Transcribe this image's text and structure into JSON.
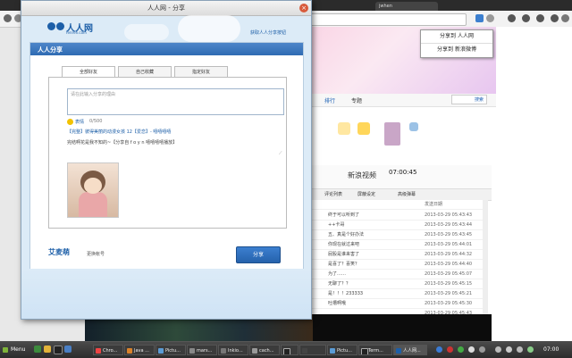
{
  "browser": {
    "tab_label": "jwhen",
    "share_menu": [
      "分享到 人人网",
      "分享到 新浪微博"
    ],
    "nav_items": [
      "排行",
      "专题"
    ],
    "search_label": "搜索",
    "video_site_label": "新浪视频",
    "video_time": "07:00:45",
    "toolbar_items": [
      "评论列表",
      "屏蔽设定",
      "高级弹幕"
    ],
    "comment_header_time": "发送日期",
    "comments": [
      {
        "text": "终于可以听到了",
        "time": "2013-03-29 05:43:43"
      },
      {
        "text": "++卡哥",
        "time": "2013-03-29 05:43:44"
      },
      {
        "text": "五、真是个好办法",
        "time": "2013-03-29 05:43:45"
      },
      {
        "text": "你现在就过来吧",
        "time": "2013-03-29 05:44:01"
      },
      {
        "text": "屁股是谁来害了",
        "time": "2013-03-29 05:44:32"
      },
      {
        "text": "是喜了？喜笑？",
        "time": "2013-03-29 05:44:40"
      },
      {
        "text": "为了……",
        "time": "2013-03-29 05:45:07"
      },
      {
        "text": "无聊了？？",
        "time": "2013-03-29 05:45:15"
      },
      {
        "text": "是！！！233333",
        "time": "2013-03-29 05:45:21"
      },
      {
        "text": "吐槽啊哦",
        "time": "2013-03-29 05:45:30"
      },
      {
        "text": "",
        "time": "2013-03-29 05:45:43"
      }
    ]
  },
  "dialog": {
    "title": "人人网 - 分享",
    "logo_text": "人人网",
    "logo_sub": "renren.com",
    "help_link": "获取人人分享按钮",
    "panel_title": "人人分享",
    "tabs": [
      "全部好友",
      "自己收藏",
      "指定好友"
    ],
    "reason_placeholder": "请在此输入分享的理由",
    "emoji_label": "表情",
    "char_count": "0/500",
    "share_title": "【完整】彼得美丽的动漫女孩 12【爱恋】- 嘻嘻嘻嘻",
    "share_desc": "完结啊花是我不知的~【分享自 f o y n 嘻嘻嘻嘻播放】",
    "user_name": "艾麦萌",
    "switch_account": "更换帐号",
    "share_button": "分享"
  },
  "taskbar": {
    "menu_label": "Menu",
    "items": [
      "Chro...",
      "Java ...",
      "Pictu...",
      "mars...",
      "Inkio...",
      "cach...",
      "",
      "Pictu...",
      "Term...",
      "人人网..."
    ],
    "clock": "07:00"
  },
  "colors": {
    "accent": "#1d5fa8",
    "panel_header": "#2f6bb3",
    "dialog_bg": "#dcebf7"
  }
}
